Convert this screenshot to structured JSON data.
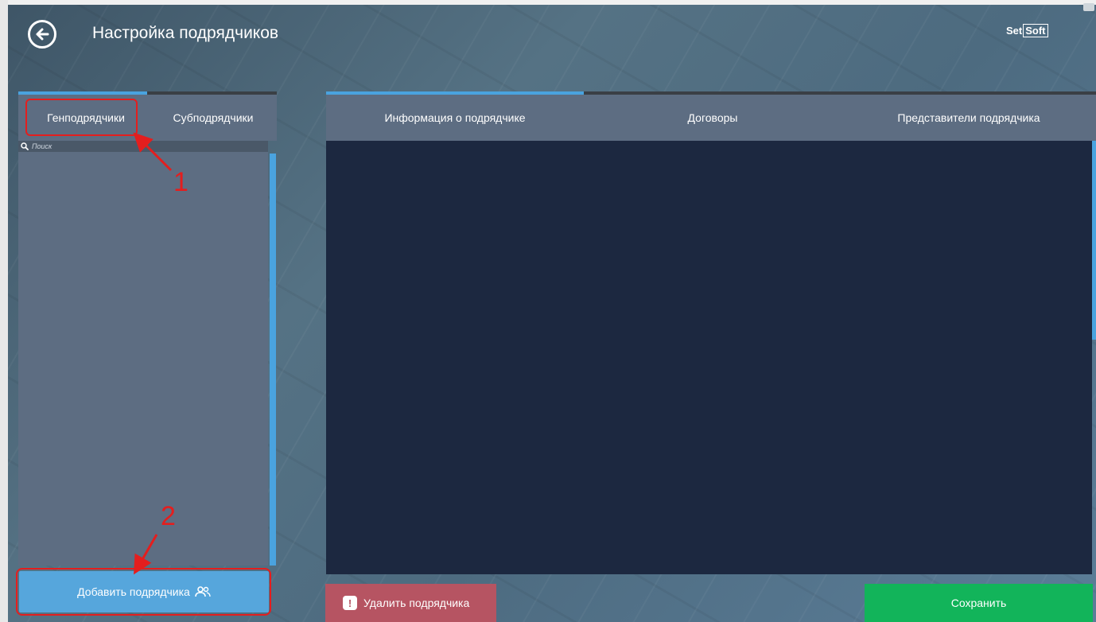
{
  "header": {
    "title": "Настройка подрядчиков",
    "logo_part1": "Set",
    "logo_part2": "Soft"
  },
  "left_panel": {
    "tabs": [
      {
        "label": "Генподрядчики",
        "active": true
      },
      {
        "label": "Субподрядчики",
        "active": false
      }
    ],
    "search_placeholder": "Поиск",
    "add_button_label": "Добавить подрядчика"
  },
  "right_panel": {
    "tabs": [
      {
        "label": "Информация о подрядчике",
        "active": true
      },
      {
        "label": "Договоры",
        "active": false
      },
      {
        "label": "Представители подрядчика",
        "active": false
      }
    ],
    "delete_button_label": "Удалить подрядчика",
    "save_button_label": "Сохранить"
  },
  "annotations": {
    "marker_1": "1",
    "marker_2": "2"
  },
  "colors": {
    "accent_blue": "#4aa3df",
    "panel": "#5d6d82",
    "content": "#1c2840",
    "delete": "#b65462",
    "save": "#12b45a",
    "annotation": "#e41e1e"
  },
  "icons": {
    "back": "arrow-left-circle-icon",
    "search": "search-icon",
    "add_user": "users-icon",
    "warning": "exclamation-icon"
  }
}
